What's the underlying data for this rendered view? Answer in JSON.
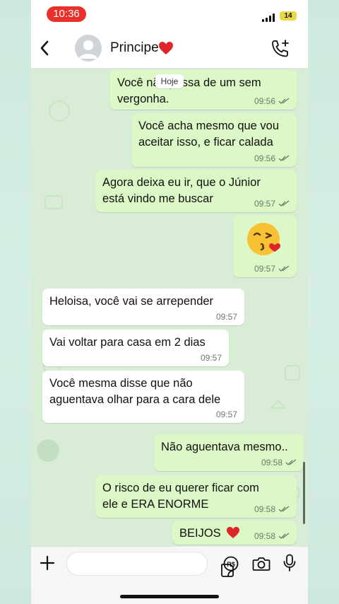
{
  "status_bar": {
    "time": "10:36",
    "battery": "14"
  },
  "header": {
    "contact_name": "Principe",
    "name_emoji": "heart-icon"
  },
  "date_chip": "Hoje",
  "messages": [
    {
      "dir": "out",
      "lines": [
        "Você não passa de um sem",
        "vergonha."
      ],
      "time": "09:56",
      "status": "read"
    },
    {
      "dir": "out",
      "lines": [
        "Você acha mesmo que vou",
        "aceitar isso, e ficar calada"
      ],
      "time": "09:56",
      "status": "read"
    },
    {
      "dir": "out",
      "lines": [
        "Agora deixa eu ir, que o Júnior",
        "está vindo me buscar"
      ],
      "time": "09:57",
      "status": "read"
    },
    {
      "dir": "out",
      "emoji": "kiss-emoji-icon",
      "time": "09:57",
      "status": "read"
    },
    {
      "dir": "in",
      "lines": [
        "Heloisa, você vai se arrepender"
      ],
      "time": "09:57"
    },
    {
      "dir": "in",
      "lines": [
        "Vai voltar para casa em 2 dias"
      ],
      "time": "09:57"
    },
    {
      "dir": "in",
      "lines": [
        "Você mesma disse que não",
        "aguentava olhar para a cara dele"
      ],
      "time": "09:57"
    },
    {
      "dir": "out",
      "lines": [
        "Não aguentava mesmo.."
      ],
      "time": "09:58",
      "status": "read"
    },
    {
      "dir": "out",
      "lines": [
        "O risco de eu querer ficar com",
        "ele e ERA ENORME"
      ],
      "time": "09:58",
      "status": "read"
    },
    {
      "dir": "out",
      "lines": [
        "BEIJOS"
      ],
      "emoji_after": "heart-icon",
      "time": "09:58",
      "status": "read"
    }
  ],
  "input_bar": {
    "message_placeholder": "",
    "icons": [
      "plus-icon",
      "sticker-icon",
      "payment-icon",
      "camera-icon",
      "mic-icon"
    ]
  },
  "colors": {
    "out_bubble": "#dcf8c6",
    "in_bubble": "#ffffff",
    "time_pill": "#e9312c",
    "read_ticks": "#6b7a6b"
  }
}
